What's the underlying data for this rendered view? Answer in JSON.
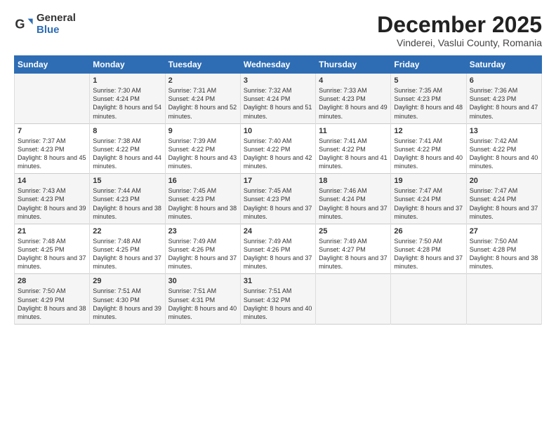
{
  "logo": {
    "general": "General",
    "blue": "Blue"
  },
  "title": "December 2025",
  "subtitle": "Vinderei, Vaslui County, Romania",
  "days": [
    "Sunday",
    "Monday",
    "Tuesday",
    "Wednesday",
    "Thursday",
    "Friday",
    "Saturday"
  ],
  "weeks": [
    [
      {
        "num": "",
        "sunrise": "",
        "sunset": "",
        "daylight": ""
      },
      {
        "num": "1",
        "sunrise": "Sunrise: 7:30 AM",
        "sunset": "Sunset: 4:24 PM",
        "daylight": "Daylight: 8 hours and 54 minutes."
      },
      {
        "num": "2",
        "sunrise": "Sunrise: 7:31 AM",
        "sunset": "Sunset: 4:24 PM",
        "daylight": "Daylight: 8 hours and 52 minutes."
      },
      {
        "num": "3",
        "sunrise": "Sunrise: 7:32 AM",
        "sunset": "Sunset: 4:24 PM",
        "daylight": "Daylight: 8 hours and 51 minutes."
      },
      {
        "num": "4",
        "sunrise": "Sunrise: 7:33 AM",
        "sunset": "Sunset: 4:23 PM",
        "daylight": "Daylight: 8 hours and 49 minutes."
      },
      {
        "num": "5",
        "sunrise": "Sunrise: 7:35 AM",
        "sunset": "Sunset: 4:23 PM",
        "daylight": "Daylight: 8 hours and 48 minutes."
      },
      {
        "num": "6",
        "sunrise": "Sunrise: 7:36 AM",
        "sunset": "Sunset: 4:23 PM",
        "daylight": "Daylight: 8 hours and 47 minutes."
      }
    ],
    [
      {
        "num": "7",
        "sunrise": "Sunrise: 7:37 AM",
        "sunset": "Sunset: 4:23 PM",
        "daylight": "Daylight: 8 hours and 45 minutes."
      },
      {
        "num": "8",
        "sunrise": "Sunrise: 7:38 AM",
        "sunset": "Sunset: 4:22 PM",
        "daylight": "Daylight: 8 hours and 44 minutes."
      },
      {
        "num": "9",
        "sunrise": "Sunrise: 7:39 AM",
        "sunset": "Sunset: 4:22 PM",
        "daylight": "Daylight: 8 hours and 43 minutes."
      },
      {
        "num": "10",
        "sunrise": "Sunrise: 7:40 AM",
        "sunset": "Sunset: 4:22 PM",
        "daylight": "Daylight: 8 hours and 42 minutes."
      },
      {
        "num": "11",
        "sunrise": "Sunrise: 7:41 AM",
        "sunset": "Sunset: 4:22 PM",
        "daylight": "Daylight: 8 hours and 41 minutes."
      },
      {
        "num": "12",
        "sunrise": "Sunrise: 7:41 AM",
        "sunset": "Sunset: 4:22 PM",
        "daylight": "Daylight: 8 hours and 40 minutes."
      },
      {
        "num": "13",
        "sunrise": "Sunrise: 7:42 AM",
        "sunset": "Sunset: 4:22 PM",
        "daylight": "Daylight: 8 hours and 40 minutes."
      }
    ],
    [
      {
        "num": "14",
        "sunrise": "Sunrise: 7:43 AM",
        "sunset": "Sunset: 4:23 PM",
        "daylight": "Daylight: 8 hours and 39 minutes."
      },
      {
        "num": "15",
        "sunrise": "Sunrise: 7:44 AM",
        "sunset": "Sunset: 4:23 PM",
        "daylight": "Daylight: 8 hours and 38 minutes."
      },
      {
        "num": "16",
        "sunrise": "Sunrise: 7:45 AM",
        "sunset": "Sunset: 4:23 PM",
        "daylight": "Daylight: 8 hours and 38 minutes."
      },
      {
        "num": "17",
        "sunrise": "Sunrise: 7:45 AM",
        "sunset": "Sunset: 4:23 PM",
        "daylight": "Daylight: 8 hours and 37 minutes."
      },
      {
        "num": "18",
        "sunrise": "Sunrise: 7:46 AM",
        "sunset": "Sunset: 4:24 PM",
        "daylight": "Daylight: 8 hours and 37 minutes."
      },
      {
        "num": "19",
        "sunrise": "Sunrise: 7:47 AM",
        "sunset": "Sunset: 4:24 PM",
        "daylight": "Daylight: 8 hours and 37 minutes."
      },
      {
        "num": "20",
        "sunrise": "Sunrise: 7:47 AM",
        "sunset": "Sunset: 4:24 PM",
        "daylight": "Daylight: 8 hours and 37 minutes."
      }
    ],
    [
      {
        "num": "21",
        "sunrise": "Sunrise: 7:48 AM",
        "sunset": "Sunset: 4:25 PM",
        "daylight": "Daylight: 8 hours and 37 minutes."
      },
      {
        "num": "22",
        "sunrise": "Sunrise: 7:48 AM",
        "sunset": "Sunset: 4:25 PM",
        "daylight": "Daylight: 8 hours and 37 minutes."
      },
      {
        "num": "23",
        "sunrise": "Sunrise: 7:49 AM",
        "sunset": "Sunset: 4:26 PM",
        "daylight": "Daylight: 8 hours and 37 minutes."
      },
      {
        "num": "24",
        "sunrise": "Sunrise: 7:49 AM",
        "sunset": "Sunset: 4:26 PM",
        "daylight": "Daylight: 8 hours and 37 minutes."
      },
      {
        "num": "25",
        "sunrise": "Sunrise: 7:49 AM",
        "sunset": "Sunset: 4:27 PM",
        "daylight": "Daylight: 8 hours and 37 minutes."
      },
      {
        "num": "26",
        "sunrise": "Sunrise: 7:50 AM",
        "sunset": "Sunset: 4:28 PM",
        "daylight": "Daylight: 8 hours and 37 minutes."
      },
      {
        "num": "27",
        "sunrise": "Sunrise: 7:50 AM",
        "sunset": "Sunset: 4:28 PM",
        "daylight": "Daylight: 8 hours and 38 minutes."
      }
    ],
    [
      {
        "num": "28",
        "sunrise": "Sunrise: 7:50 AM",
        "sunset": "Sunset: 4:29 PM",
        "daylight": "Daylight: 8 hours and 38 minutes."
      },
      {
        "num": "29",
        "sunrise": "Sunrise: 7:51 AM",
        "sunset": "Sunset: 4:30 PM",
        "daylight": "Daylight: 8 hours and 39 minutes."
      },
      {
        "num": "30",
        "sunrise": "Sunrise: 7:51 AM",
        "sunset": "Sunset: 4:31 PM",
        "daylight": "Daylight: 8 hours and 40 minutes."
      },
      {
        "num": "31",
        "sunrise": "Sunrise: 7:51 AM",
        "sunset": "Sunset: 4:32 PM",
        "daylight": "Daylight: 8 hours and 40 minutes."
      },
      {
        "num": "",
        "sunrise": "",
        "sunset": "",
        "daylight": ""
      },
      {
        "num": "",
        "sunrise": "",
        "sunset": "",
        "daylight": ""
      },
      {
        "num": "",
        "sunrise": "",
        "sunset": "",
        "daylight": ""
      }
    ]
  ]
}
